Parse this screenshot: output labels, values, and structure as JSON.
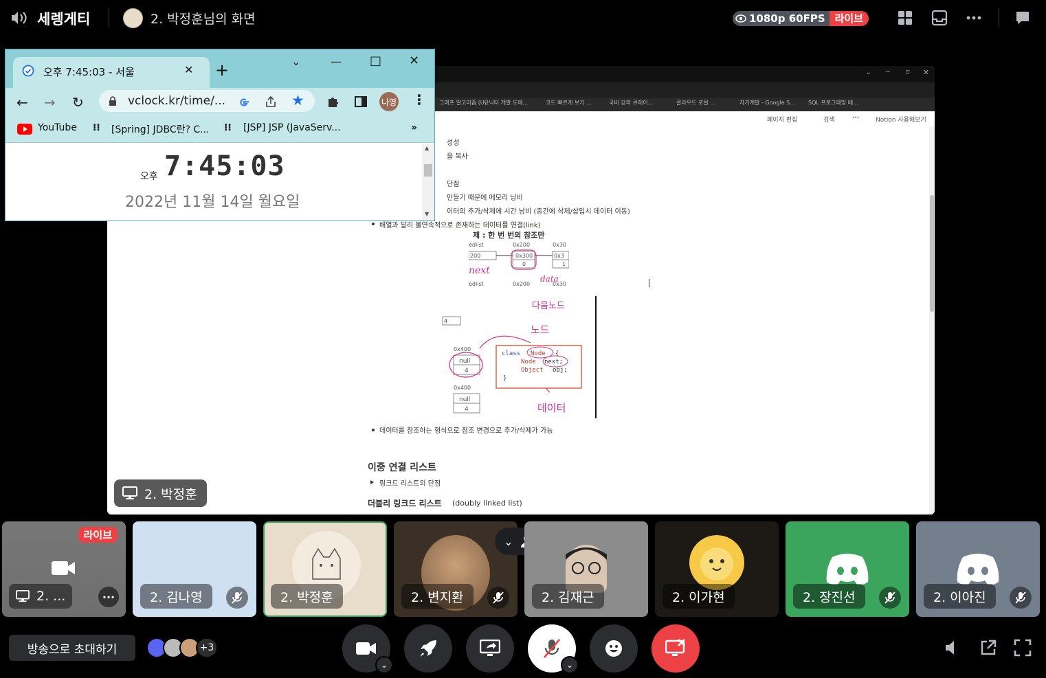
{
  "topbar": {
    "channel_name": "세렝게티",
    "stream_title": "2. 박정훈님의 화면",
    "quality": "1080p 60FPS",
    "live_label": "라이브"
  },
  "clock_browser": {
    "tab_title": "오후 7:45:03 - 서울",
    "url": "vclock.kr/time/...",
    "profile_label": "나영",
    "bookmarks": [
      "YouTube",
      "[Spring] JDBC란? C...",
      "[JSP] JSP (JavaServ..."
    ],
    "bookmark_overflow": "»",
    "ampm": "오후",
    "time": "7:45:03",
    "date": "2022년 11월 14일 월요일"
  },
  "shared_screen": {
    "presenter": "2. 박정훈",
    "notion_toolbar": [
      "페이지 편집",
      "검색",
      "Notion 사용해보기"
    ],
    "bookmarks": [
      "그래프 알고리즘 (U...",
      "유닉터 개발 도메...",
      "코드 빠르게 보기 ...",
      "국비 강의 큐레이...",
      "클라우드 포털 ...",
      "자기계발 - Google S...",
      "SQL 프로그래밍 배..."
    ],
    "doc_lines": [
      "성성",
      "을 복사",
      "단점",
      "만들기 때문에 메모리 낭비",
      "이터의 추가/삭제에 시간 낭비 (중간에 삭제/삽입시 데이터 이동)",
      "배열과 달리 불연속적으로 존재하는 데이터를 연결(link)",
      "데이터를 참조하는 형식으로 참조 변경으로 추가/삭제가 가능"
    ],
    "diagram1": {
      "top_text": "제 : 한 번 번의 참조만",
      "labels": [
        "edlist",
        "0x200",
        "0x30",
        "200",
        "0x300",
        "0x3",
        "0",
        "1",
        "edlist",
        "0x200",
        "0x30"
      ],
      "handwriting": [
        "next",
        "data"
      ]
    },
    "diagram2": {
      "header": "하는 데이터를 연결(link)",
      "handwriting": [
        "다음노드",
        "노드",
        "데이터"
      ],
      "code": [
        "class Node {",
        "Node next;",
        "Object obj;",
        "}"
      ],
      "nodes": [
        "0x400",
        "null",
        "4",
        "0x400",
        "null",
        "4",
        "4"
      ]
    },
    "heading": "이중 연결 리스트",
    "toggle": "링크드 리스트의 단점",
    "subheading": "더블리 링크드 리스트",
    "subheading_en": "(doubly linked list)"
  },
  "participants": [
    {
      "name": "2. ...",
      "type": "stream",
      "live": "라이브"
    },
    {
      "name": "2. 김나영",
      "muted": true,
      "bg": "#cfe0f2"
    },
    {
      "name": "2. 박정훈",
      "muted": false,
      "bg": "#e8dccb",
      "selected": true
    },
    {
      "name": "2. 변지환",
      "muted": true,
      "bg": "#3b3026"
    },
    {
      "name": "2. 김재근",
      "muted": false,
      "bg": "#8c8c8c"
    },
    {
      "name": "2. 이가현",
      "muted": false,
      "bg": "#1d1a15"
    },
    {
      "name": "2. 장진선",
      "muted": true,
      "bg": "#3ba55d"
    },
    {
      "name": "2. 이아진",
      "muted": true,
      "bg": "#747f8d"
    }
  ],
  "bottom": {
    "invite_label": "방송으로 초대하기",
    "viewer_more": "+3"
  },
  "colors": {
    "live": "#ed4245",
    "discord_green": "#3ba55d",
    "accent_blue": "#1a73e8"
  }
}
